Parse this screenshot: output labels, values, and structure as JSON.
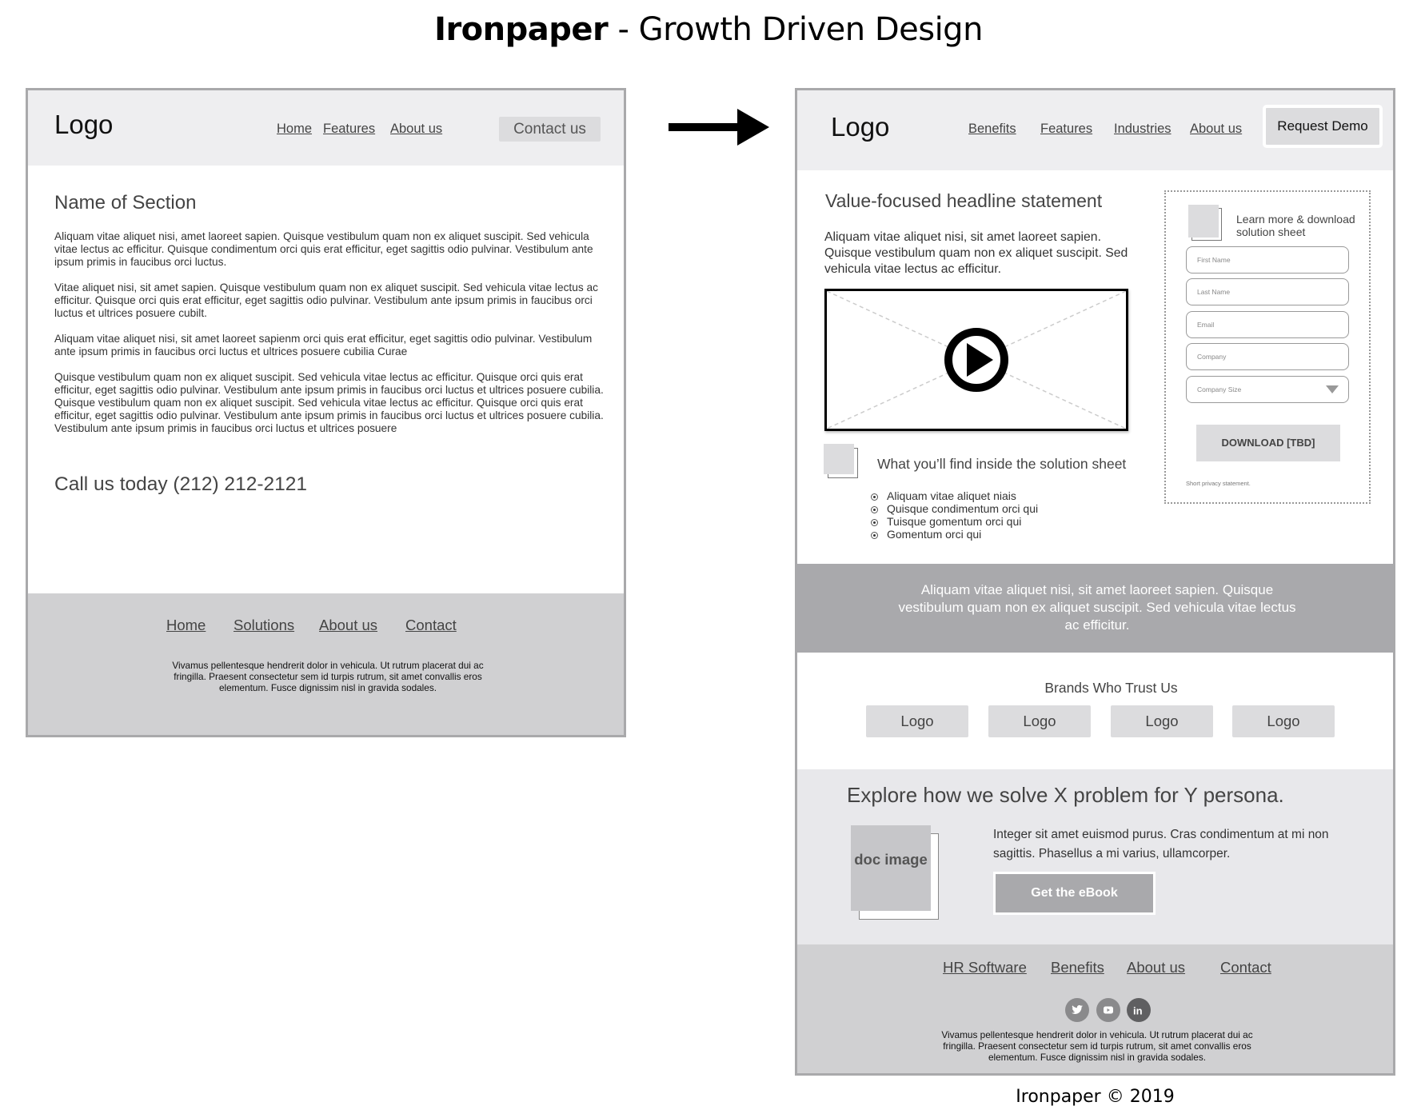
{
  "title": {
    "brand": "Ironpaper",
    "subtitle": " - Growth Driven Design"
  },
  "copyright": "Ironpaper © 2019",
  "before": {
    "header": {
      "logo": "Logo",
      "nav": [
        "Home",
        "Features",
        "About us"
      ],
      "cta": "Contact us"
    },
    "section_title": "Name of Section",
    "paragraphs": [
      "Aliquam vitae aliquet nisi, amet laoreet sapien. Quisque vestibulum quam non ex aliquet suscipit. Sed vehicula vitae lectus ac efficitur. Quisque condimentum orci quis erat efficitur, eget sagittis odio pulvinar. Vestibulum ante ipsum primis in faucibus orci luctus.",
      "Vitae aliquet nisi, sit amet sapien. Quisque vestibulum quam non ex aliquet suscipit. Sed vehicula vitae lectus ac efficitur. Quisque orci quis erat efficitur, eget sagittis odio pulvinar. Vestibulum ante ipsum primis in faucibus orci luctus et ultrices posuere cubilt.",
      "Aliquam vitae aliquet nisi, sit amet laoreet sapienm orci quis erat efficitur, eget sagittis odio pulvinar. Vestibulum ante ipsum primis in faucibus orci luctus et ultrices posuere cubilia Curae",
      "Quisque vestibulum quam non ex aliquet suscipit. Sed vehicula vitae lectus ac efficitur. Quisque orci quis erat efficitur, eget sagittis odio pulvinar. Vestibulum ante ipsum primis in faucibus orci luctus et ultrices posuere cubilia. Quisque vestibulum quam non ex aliquet suscipit. Sed vehicula vitae lectus ac efficitur. Quisque orci quis erat efficitur, eget sagittis odio pulvinar. Vestibulum ante ipsum primis in faucibus orci luctus et ultrices posuere cubilia. Vestibulum ante ipsum primis in faucibus orci luctus et ultrices posuere"
    ],
    "call_us": "Call us today (212) 212-2121",
    "footer": {
      "nav": [
        "Home",
        "Solutions",
        "About us",
        "Contact"
      ],
      "text": "Vivamus pellentesque hendrerit dolor in vehicula. Ut rutrum placerat dui ac fringilla. Praesent consectetur sem id turpis rutrum, sit amet convallis eros elementum. Fusce dignissim nisl in gravida sodales."
    }
  },
  "after": {
    "header": {
      "logo": "Logo",
      "nav": [
        "Benefits",
        "Features ",
        "Industries",
        "About us"
      ],
      "cta": "Request Demo"
    },
    "hero": {
      "title": "Value-focused headline statement",
      "text": "Aliquam vitae aliquet nisi, sit amet laoreet sapien. Quisque vestibulum quam non ex aliquet suscipit. Sed vehicula vitae lectus ac efficitur.",
      "video_icon": "play-icon"
    },
    "find_inside": {
      "title": "What you’ll find inside the solution sheet",
      "items": [
        "Aliquam vitae aliquet niais",
        "Quisque condimentum orci qui",
        "Tuisque gomentum orci qui",
        "Gomentum orci qui"
      ]
    },
    "form": {
      "heading": "Learn more & download solution sheet",
      "fields": [
        {
          "placeholder": "First Name"
        },
        {
          "placeholder": "Last Name"
        },
        {
          "placeholder": "Email"
        },
        {
          "placeholder": "Company"
        },
        {
          "placeholder": "Company Size",
          "type": "select"
        }
      ],
      "submit": "DOWNLOAD [TBD]",
      "privacy": "Short privacy statement."
    },
    "band_text": "Aliquam vitae aliquet nisi, sit amet laoreet sapien. Quisque vestibulum quam non ex aliquet suscipit. Sed vehicula vitae lectus ac efficitur.",
    "brands": {
      "title": "Brands Who Trust Us",
      "logos": [
        "Logo",
        "Logo",
        "Logo",
        "Logo"
      ]
    },
    "explore": {
      "title": "Explore how we solve X problem for Y persona.",
      "doc_image": "doc image",
      "text": "Integer sit amet euismod purus. Cras condimentum at mi non sagittis. Phasellus a mi varius, ullamcorper.",
      "button": "Get the eBook"
    },
    "footer": {
      "nav": [
        "HR Software",
        "Benefits",
        "About us",
        "Contact"
      ],
      "social": [
        "twitter-icon",
        "youtube-icon",
        "linkedin-icon"
      ],
      "text": "Vivamus pellentesque hendrerit dolor in vehicula. Ut rutrum placerat dui ac fringilla. Praesent consectetur sem id turpis rutrum, sit amet convallis eros elementum. Fusce dignissim nisl in gravida sodales."
    }
  }
}
